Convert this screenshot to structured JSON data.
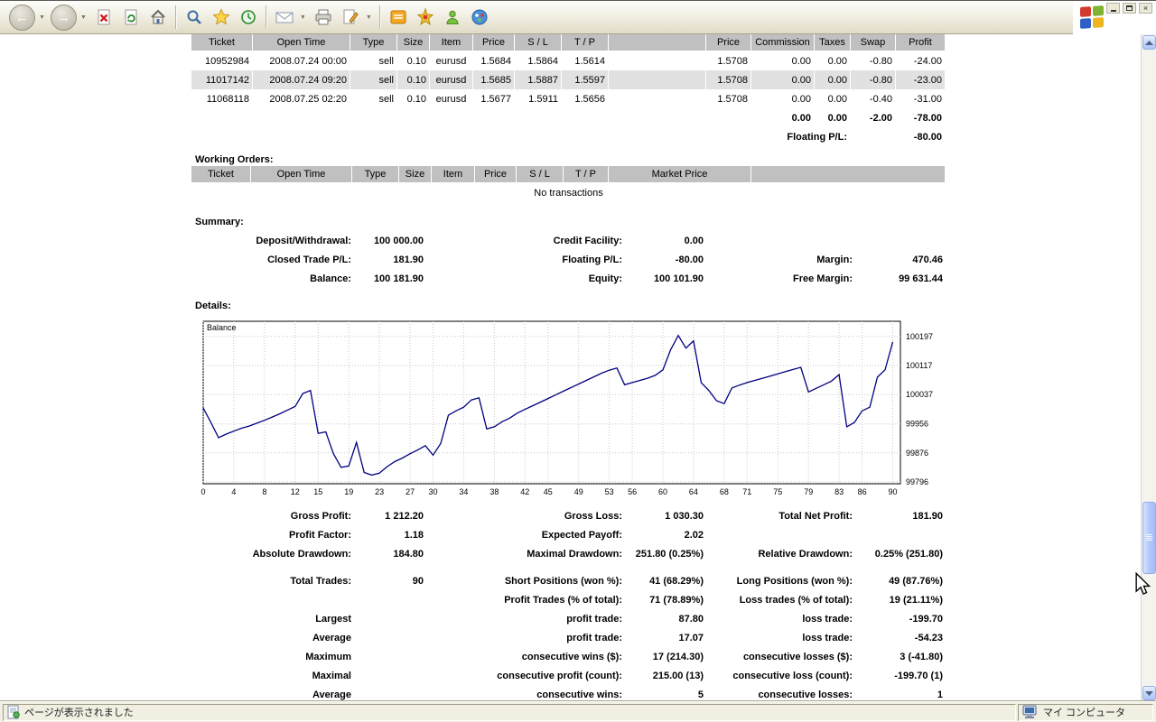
{
  "colors": {
    "table_header_bg": "#c0c0c0",
    "row_alt_bg": "#e1e1e1",
    "chart_line": "#000080",
    "toolbar_bg": "#ece9d8"
  },
  "toolbar": {
    "buttons": [
      "back",
      "forward",
      "stop",
      "refresh",
      "home",
      "search",
      "favorites",
      "history",
      "mail",
      "print",
      "edit",
      "document",
      "star",
      "messenger",
      "apps"
    ]
  },
  "window_controls": {
    "close_glyph": "×"
  },
  "statusbar": {
    "left_text": "ページが表示されました",
    "right_text": "マイ コンピュータ"
  },
  "open_trades": {
    "headers": [
      "Ticket",
      "Open Time",
      "Type",
      "Size",
      "Item",
      "Price",
      "S / L",
      "T / P",
      "",
      "Price",
      "Commission",
      "Taxes",
      "Swap",
      "Profit"
    ],
    "rows": [
      [
        "10952984",
        "2008.07.24 00:00",
        "sell",
        "0.10",
        "eurusd",
        "1.5684",
        "1.5864",
        "1.5614",
        "",
        "1.5708",
        "0.00",
        "0.00",
        "-0.80",
        "-24.00"
      ],
      [
        "11017142",
        "2008.07.24 09:20",
        "sell",
        "0.10",
        "eurusd",
        "1.5685",
        "1.5887",
        "1.5597",
        "",
        "1.5708",
        "0.00",
        "0.00",
        "-0.80",
        "-23.00"
      ],
      [
        "11068118",
        "2008.07.25 02:20",
        "sell",
        "0.10",
        "eurusd",
        "1.5677",
        "1.5911",
        "1.5656",
        "",
        "1.5708",
        "0.00",
        "0.00",
        "-0.40",
        "-31.00"
      ]
    ],
    "totals": [
      "0.00",
      "0.00",
      "-2.00",
      "-78.00"
    ],
    "floating_label": "Floating P/L:",
    "floating_value": "-80.00"
  },
  "working_orders": {
    "title": "Working Orders:",
    "headers": [
      "Ticket",
      "Open Time",
      "Type",
      "Size",
      "Item",
      "Price",
      "S / L",
      "T / P",
      "Market Price",
      ""
    ],
    "empty_text": "No transactions"
  },
  "summary": {
    "title": "Summary:",
    "rows": [
      [
        "Deposit/Withdrawal:",
        "100 000.00",
        "Credit Facility:",
        "0.00",
        "",
        ""
      ],
      [
        "Closed Trade P/L:",
        "181.90",
        "Floating P/L:",
        "-80.00",
        "Margin:",
        "470.46"
      ],
      [
        "Balance:",
        "100 181.90",
        "Equity:",
        "100 101.90",
        "Free Margin:",
        "99 631.44"
      ]
    ]
  },
  "details": {
    "title": "Details:",
    "stats": [
      [
        "Gross Profit:",
        "1 212.20",
        "Gross Loss:",
        "1 030.30",
        "Total Net Profit:",
        "181.90"
      ],
      [
        "Profit Factor:",
        "1.18",
        "Expected Payoff:",
        "2.02",
        "",
        ""
      ],
      [
        "Absolute Drawdown:",
        "184.80",
        "Maximal Drawdown:",
        "251.80 (0.25%)",
        "Relative Drawdown:",
        "0.25% (251.80)"
      ],
      [
        "Total Trades:",
        "90",
        "Short Positions (won %):",
        "41 (68.29%)",
        "Long Positions (won %):",
        "49 (87.76%)"
      ],
      [
        "",
        "",
        "Profit Trades (% of total):",
        "71 (78.89%)",
        "Loss trades (% of total):",
        "19 (21.11%)"
      ],
      [
        "Largest",
        "",
        "profit trade:",
        "87.80",
        "loss trade:",
        "-199.70"
      ],
      [
        "Average",
        "",
        "profit trade:",
        "17.07",
        "loss trade:",
        "-54.23"
      ],
      [
        "Maximum",
        "",
        "consecutive wins ($):",
        "17 (214.30)",
        "consecutive losses ($):",
        "3 (-41.80)"
      ],
      [
        "Maximal",
        "",
        "consecutive profit (count):",
        "215.00 (13)",
        "consecutive loss (count):",
        "-199.70 (1)"
      ],
      [
        "Average",
        "",
        "consecutive wins:",
        "5",
        "consecutive losses:",
        "1"
      ]
    ]
  },
  "chart_data": {
    "type": "line",
    "title": "Balance",
    "series": [
      {
        "name": "Balance",
        "values": [
          100000,
          99960,
          99918,
          99928,
          99936,
          99944,
          99950,
          99958,
          99966,
          99975,
          99984,
          99994,
          100004,
          100040,
          100048,
          99930,
          99934,
          99874,
          99836,
          99840,
          99905,
          99822,
          99815,
          99820,
          99838,
          99852,
          99862,
          99874,
          99884,
          99896,
          99870,
          99902,
          99980,
          99992,
          100002,
          100022,
          100028,
          99942,
          99948,
          99962,
          99972,
          99986,
          99996,
          100006,
          100016,
          100026,
          100036,
          100046,
          100056,
          100066,
          100076,
          100086,
          100096,
          100104,
          100110,
          100064,
          100070,
          100076,
          100082,
          100090,
          100105,
          100160,
          100200,
          100165,
          100185,
          100070,
          100048,
          100020,
          100012,
          100055,
          100063,
          100070,
          100076,
          100082,
          100088,
          100094,
          100100,
          100106,
          100112,
          100044,
          100054,
          100064,
          100074,
          100092,
          99948,
          99960,
          99992,
          100002,
          100085,
          100105,
          100182
        ]
      }
    ],
    "xticks": [
      0,
      4,
      8,
      12,
      15,
      19,
      23,
      27,
      30,
      34,
      38,
      42,
      45,
      49,
      53,
      56,
      60,
      64,
      68,
      71,
      75,
      79,
      83,
      86,
      90
    ],
    "yticks": [
      100197,
      100117,
      100037,
      99956,
      99876,
      99796
    ],
    "xlim": [
      0,
      91
    ],
    "ylim": [
      99791,
      100239
    ],
    "grid": true,
    "legend_position": "none",
    "line_color": "#000080"
  }
}
